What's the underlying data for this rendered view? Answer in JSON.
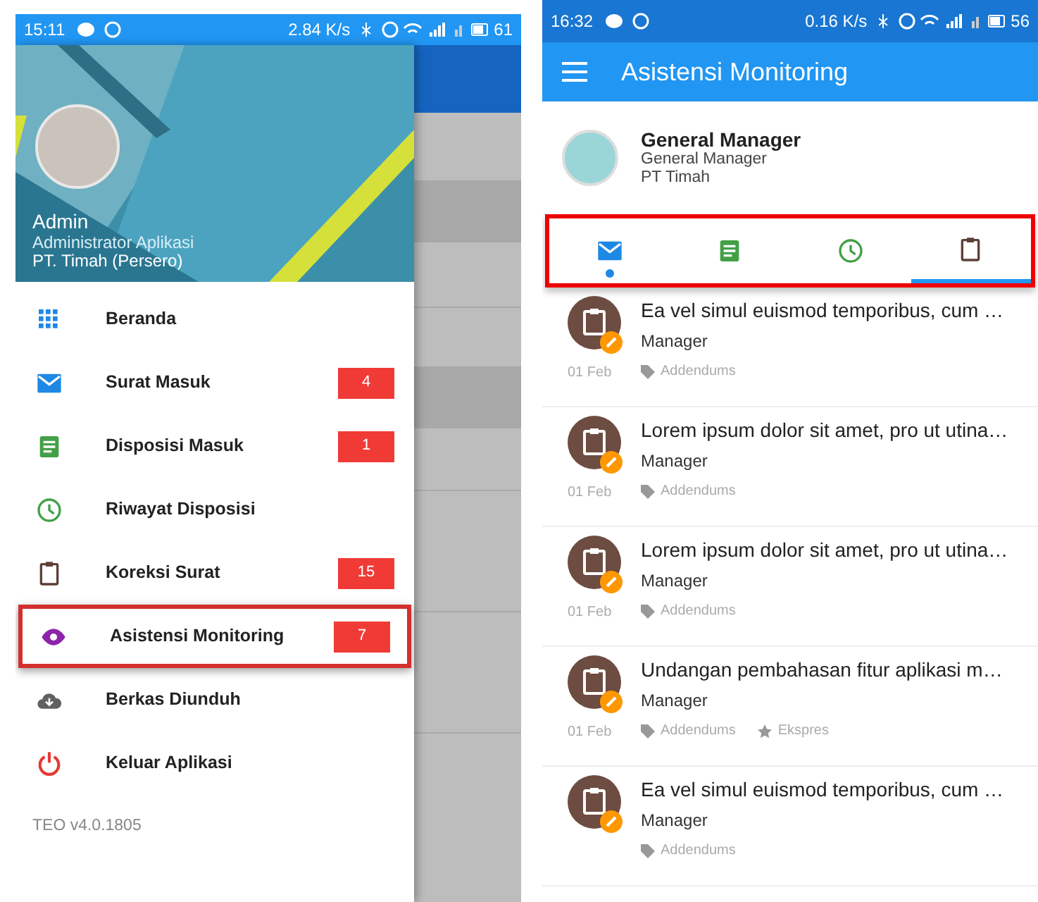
{
  "left": {
    "status_bar": {
      "time": "15:11",
      "speed": "2.84 K/s",
      "battery": "61"
    },
    "profile": {
      "name": "Admin",
      "role": "Administrator Aplikasi",
      "company": "PT. Timah (Persero)"
    },
    "menu": [
      {
        "kind": "grid",
        "label": "Beranda",
        "highlighted": false
      },
      {
        "kind": "mail",
        "label": "Surat Masuk",
        "count": "4",
        "highlighted": false
      },
      {
        "kind": "document",
        "label": "Disposisi Masuk",
        "count": "1",
        "highlighted": false
      },
      {
        "kind": "clock",
        "label": "Riwayat Disposisi",
        "highlighted": false
      },
      {
        "kind": "clipboard",
        "label": "Koreksi Surat",
        "count": "15",
        "highlighted": false
      },
      {
        "kind": "eye",
        "label": "Asistensi Monitoring",
        "count": "7",
        "highlighted": true
      },
      {
        "kind": "cloud",
        "label": "Berkas Diunduh",
        "highlighted": false
      },
      {
        "kind": "power",
        "label": "Keluar Aplikasi",
        "highlighted": false
      }
    ],
    "version": "TEO v4.0.1805"
  },
  "right": {
    "status_bar": {
      "time": "16:32",
      "speed": "0.16 K/s",
      "battery": "56"
    },
    "app_bar": {
      "title": "Asistensi Monitoring"
    },
    "profile": {
      "name": "General Manager",
      "role": "General Manager",
      "company": "PT Timah"
    },
    "tabs": {
      "highlighted": true,
      "items": [
        {
          "kind": "mail",
          "selected": false,
          "dot": true
        },
        {
          "kind": "document",
          "selected": false,
          "dot": false
        },
        {
          "kind": "clock",
          "selected": false,
          "dot": false
        },
        {
          "kind": "clipboard",
          "selected": true,
          "dot": false
        }
      ]
    },
    "messages": [
      {
        "title": "Ea vel simul euismod temporibus, cum …",
        "sender": "Manager",
        "date": "01 Feb",
        "tags": [
          {
            "kind": "tag",
            "label": "Addendums"
          }
        ]
      },
      {
        "title": "Lorem ipsum dolor sit amet, pro ut utina…",
        "sender": "Manager",
        "date": "01 Feb",
        "tags": [
          {
            "kind": "tag",
            "label": "Addendums"
          }
        ]
      },
      {
        "title": "Lorem ipsum dolor sit amet, pro ut utina…",
        "sender": "Manager",
        "date": "01 Feb",
        "tags": [
          {
            "kind": "tag",
            "label": "Addendums"
          }
        ]
      },
      {
        "title": "Undangan pembahasan fitur aplikasi m…",
        "sender": "Manager",
        "date": "01 Feb",
        "tags": [
          {
            "kind": "tag",
            "label": "Addendums"
          },
          {
            "kind": "star",
            "label": "Ekspres"
          }
        ]
      },
      {
        "title": "Ea vel simul euismod temporibus, cum …",
        "sender": "Manager",
        "tags": [
          {
            "kind": "tag",
            "label": "Addendums"
          }
        ]
      }
    ]
  }
}
